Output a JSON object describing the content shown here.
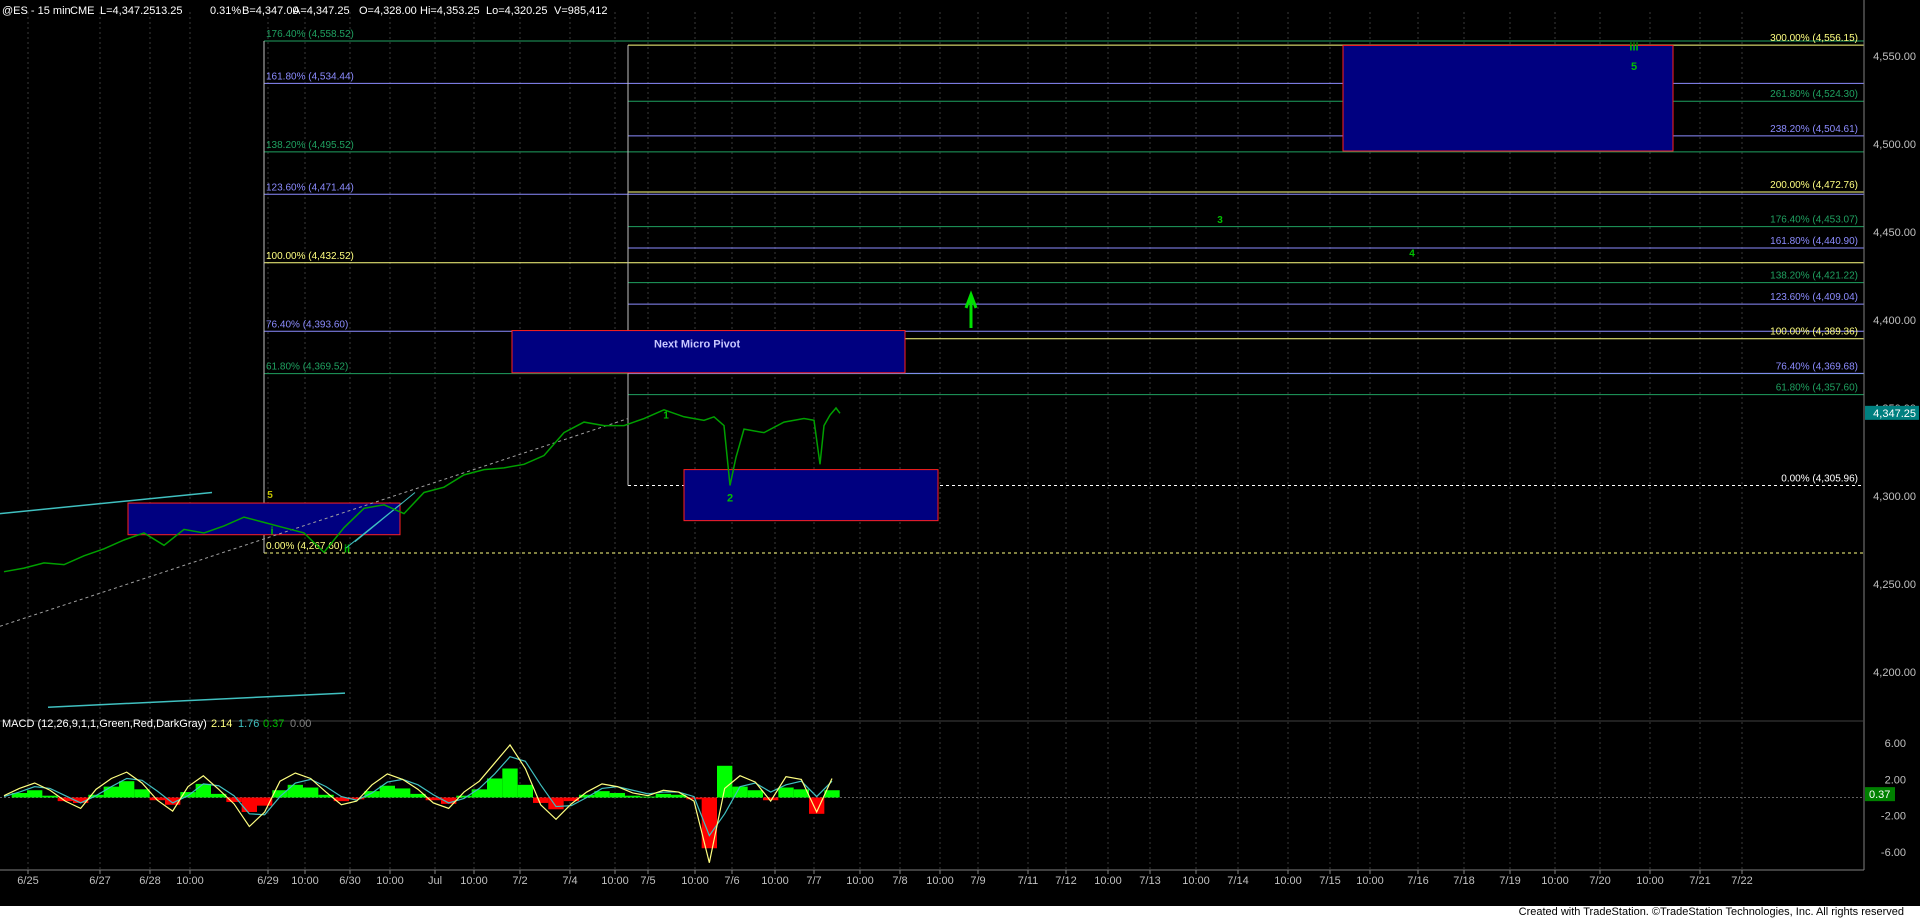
{
  "header": {
    "symbol": "@ES - 15 min",
    "exchange": "CME",
    "last": "L=4,347.25",
    "change": "13.25",
    "change_pct": "0.31%",
    "bid": "B=4,347.00",
    "ask": "A=4,347.25",
    "open": "O=4,328.00",
    "high": "Hi=4,353.25",
    "low": "Lo=4,320.25",
    "volume": "V=985,412"
  },
  "macd": {
    "label": "MACD (12,26,9,1,1,Green,Red,DarkGray)",
    "v1": "2.14",
    "v2": "1.76",
    "v3": "0.37",
    "v4": "0.00",
    "current_tag": "0.37"
  },
  "footer": "Created with TradeStation. ©TradeStation Technologies, Inc. All rights reserved",
  "colors": {
    "background": "#000000",
    "price": "#00a000",
    "fib_left": "#8c8cff",
    "fib_right": "#8c8cff",
    "fib_green": "#1fa060",
    "fib_yellow": "#ffff80",
    "box_fill": "#000080",
    "box_border": "#ff2020",
    "trend": "#40c0c0",
    "wave": "#00c000",
    "macd_hist_pos": "#00ff00",
    "macd_hist_neg": "#ff0000",
    "macd_line": "#ffff80",
    "signal_line": "#40c0c0"
  },
  "chart_data": {
    "type": "line",
    "title": "@ES - 15 min",
    "price_axis": {
      "ylim": [
        4175,
        4575
      ],
      "ticks": [
        "4,550.00",
        "4,500.00",
        "4,450.00",
        "4,400.00",
        "4,350.00",
        "4,300.00",
        "4,250.00",
        "4,200.00"
      ],
      "tick_values": [
        4550,
        4500,
        4450,
        4400,
        4350,
        4300,
        4250,
        4200
      ],
      "last_tag": "4,347.25",
      "last_value": 4347.25
    },
    "macd_axis": {
      "ylim": [
        -8,
        8
      ],
      "ticks": [
        "6.00",
        "2.00",
        "-2.00",
        "-6.00"
      ],
      "tick_values": [
        6,
        2,
        -2,
        -6
      ]
    },
    "x_ticks": [
      "6/25",
      "6/27",
      "6/28",
      "10:00",
      "6/29",
      "10:00",
      "6/30",
      "10:00",
      "Jul",
      "10:00",
      "7/2",
      "7/4",
      "10:00",
      "7/5",
      "10:00",
      "7/6",
      "10:00",
      "7/7",
      "10:00",
      "7/8",
      "10:00",
      "7/9",
      "7/11",
      "7/12",
      "10:00",
      "7/13",
      "10:00",
      "7/14",
      "10:00",
      "7/15",
      "10:00",
      "7/16",
      "7/18",
      "7/19",
      "10:00",
      "7/20",
      "10:00",
      "7/21",
      "7/22"
    ],
    "price_series": {
      "name": "@ES",
      "points": [
        [
          0,
          4257
        ],
        [
          20,
          4259
        ],
        [
          40,
          4262
        ],
        [
          60,
          4261
        ],
        [
          80,
          4266
        ],
        [
          100,
          4270
        ],
        [
          120,
          4275
        ],
        [
          140,
          4279
        ],
        [
          160,
          4272
        ],
        [
          180,
          4281
        ],
        [
          200,
          4279
        ],
        [
          220,
          4283
        ],
        [
          240,
          4288
        ],
        [
          260,
          4285
        ],
        [
          280,
          4282
        ],
        [
          300,
          4279
        ],
        [
          320,
          4268
        ],
        [
          340,
          4282
        ],
        [
          360,
          4293
        ],
        [
          380,
          4295
        ],
        [
          400,
          4290
        ],
        [
          420,
          4302
        ],
        [
          440,
          4305
        ],
        [
          460,
          4312
        ],
        [
          480,
          4315
        ],
        [
          500,
          4316
        ],
        [
          520,
          4318
        ],
        [
          540,
          4323
        ],
        [
          560,
          4336
        ],
        [
          580,
          4342
        ],
        [
          600,
          4340
        ],
        [
          620,
          4340
        ],
        [
          640,
          4344
        ],
        [
          660,
          4349
        ],
        [
          680,
          4345
        ],
        [
          700,
          4343
        ],
        [
          710,
          4345
        ],
        [
          720,
          4340
        ],
        [
          726,
          4306
        ],
        [
          732,
          4322
        ],
        [
          740,
          4338
        ],
        [
          760,
          4336
        ],
        [
          780,
          4342
        ],
        [
          800,
          4344
        ],
        [
          810,
          4343
        ],
        [
          816,
          4318
        ],
        [
          820,
          4340
        ],
        [
          826,
          4346
        ],
        [
          832,
          4350
        ],
        [
          836,
          4347
        ]
      ]
    },
    "fib_left": [
      {
        "label": "176.40% (4,558.52)",
        "value": 4558.52,
        "color": "#1fa060"
      },
      {
        "label": "161.80% (4,534.44)",
        "value": 4534.44,
        "color": "#8c8cff"
      },
      {
        "label": "138.20% (4,495.52)",
        "value": 4495.52,
        "color": "#1fa060"
      },
      {
        "label": "123.60% (4,471.44)",
        "value": 4471.44,
        "color": "#8c8cff"
      },
      {
        "label": "100.00% (4,432.52)",
        "value": 4432.52,
        "color": "#ffff80"
      },
      {
        "label": "76.40% (4,393.60)",
        "value": 4393.6,
        "color": "#8c8cff"
      },
      {
        "label": "61.80% (4,369.52)",
        "value": 4369.52,
        "color": "#1fa060"
      },
      {
        "label": "0.00% (4,267.60)",
        "value": 4267.6,
        "color": "#ffff80"
      }
    ],
    "fib_right": [
      {
        "label": "300.00% (4,556.15)",
        "value": 4556.15,
        "color": "#ffff80"
      },
      {
        "label": "261.80% (4,524.30)",
        "value": 4524.3,
        "color": "#1fa060"
      },
      {
        "label": "238.20% (4,504.61)",
        "value": 4504.61,
        "color": "#8c8cff"
      },
      {
        "label": "200.00% (4,472.76)",
        "value": 4472.76,
        "color": "#ffff80"
      },
      {
        "label": "176.40% (4,453.07)",
        "value": 4453.07,
        "color": "#1fa060"
      },
      {
        "label": "161.80% (4,440.90)",
        "value": 4440.9,
        "color": "#8c8cff"
      },
      {
        "label": "138.20% (4,421.22)",
        "value": 4421.22,
        "color": "#1fa060"
      },
      {
        "label": "123.60% (4,409.04)",
        "value": 4409.04,
        "color": "#8c8cff"
      },
      {
        "label": "100.00% (4,389.36)",
        "value": 4389.36,
        "color": "#ffff80"
      },
      {
        "label": "76.40% (4,369.68)",
        "value": 4369.68,
        "color": "#8c8cff"
      },
      {
        "label": "61.80% (4,357.60)",
        "value": 4357.6,
        "color": "#1fa060"
      },
      {
        "label": "0.00% (4,305.96)",
        "value": 4305.96,
        "color": "#ffffff"
      }
    ],
    "boxes": [
      {
        "label": "",
        "y_top": 4296,
        "y_bottom": 4278
      },
      {
        "label": "Next Micro Pivot",
        "y_top": 4394,
        "y_bottom": 4370
      },
      {
        "label": "",
        "y_top": 4315,
        "y_bottom": 4286
      },
      {
        "label": "",
        "y_top": 4556,
        "y_bottom": 4496
      }
    ],
    "wave_labels": [
      "i",
      "5",
      "ii",
      "1",
      "2",
      "3",
      "4",
      "iii",
      "5"
    ],
    "macd_hist": [
      0,
      0.5,
      0.8,
      0.2,
      -0.4,
      -0.6,
      0.3,
      1.2,
      1.8,
      0.9,
      -0.3,
      -0.8,
      0.6,
      1.5,
      0.4,
      -0.5,
      -1.6,
      -0.9,
      0.8,
      1.4,
      1.1,
      0.3,
      -0.4,
      -0.2,
      0.7,
      1.3,
      1.0,
      0.4,
      -0.3,
      -0.7,
      0.2,
      0.9,
      2.1,
      3.2,
      1.4,
      -0.6,
      -1.3,
      -0.4,
      0.3,
      0.7,
      0.5,
      0.2,
      0.1,
      0.4,
      0.3,
      -0.2,
      -5.6,
      3.5,
      1.2,
      0.8,
      -0.3,
      1.1,
      0.9,
      -1.8,
      0.8
    ],
    "macd_line": [
      0.2,
      1.0,
      1.6,
      0.8,
      -0.4,
      -1.2,
      0.9,
      2.1,
      2.8,
      1.6,
      -0.3,
      -1.5,
      1.2,
      2.4,
      0.9,
      -0.7,
      -3.2,
      -1.6,
      1.8,
      2.7,
      2.1,
      0.6,
      -0.8,
      -0.4,
      1.4,
      2.6,
      2.0,
      0.9,
      -0.6,
      -1.2,
      0.6,
      1.8,
      3.8,
      5.8,
      3.2,
      -0.8,
      -2.4,
      -0.7,
      0.6,
      1.5,
      1.2,
      0.5,
      0.2,
      0.8,
      0.6,
      -0.4,
      -7.2,
      1.0,
      2.4,
      1.7,
      -0.4,
      2.3,
      2.0,
      -1.6,
      2.1
    ],
    "signal_line": [
      0.1,
      0.6,
      1.2,
      1.0,
      0.2,
      -0.6,
      0.2,
      1.2,
      2.1,
      1.9,
      0.7,
      -0.6,
      0.2,
      1.5,
      1.3,
      0.2,
      -1.8,
      -1.9,
      0.1,
      1.6,
      2.0,
      1.2,
      0.1,
      -0.3,
      0.5,
      1.7,
      2.0,
      1.4,
      0.3,
      -0.6,
      -0.1,
      1.0,
      2.6,
      4.5,
      4.0,
      1.4,
      -1.0,
      -0.9,
      0.0,
      1.0,
      1.2,
      0.8,
      0.4,
      0.6,
      0.6,
      0.1,
      -4.2,
      -1.8,
      1.2,
      1.6,
      0.6,
      1.4,
      1.8,
      0.1,
      1.8
    ]
  }
}
